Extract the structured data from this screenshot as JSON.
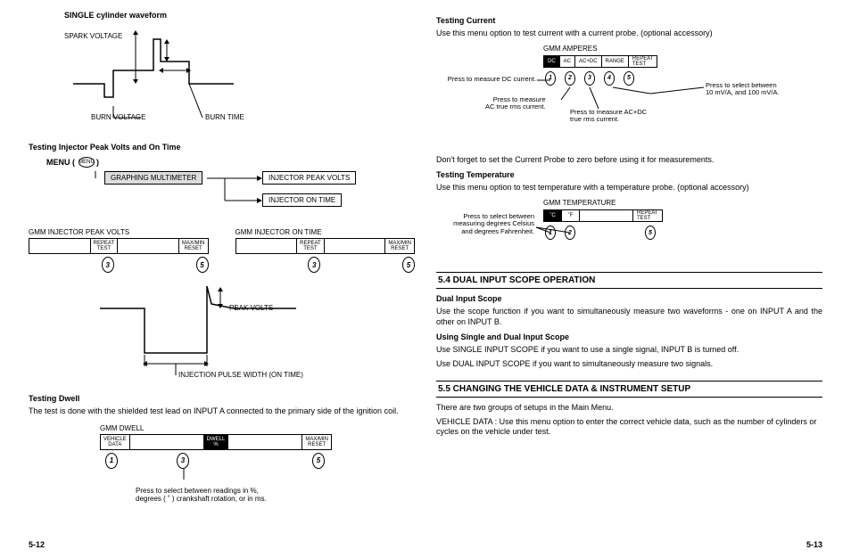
{
  "left": {
    "wave_title": "SINGLE cylinder waveform",
    "spark_v": "SPARK VOLTAGE",
    "burn_v": "BURN VOLTAGE",
    "burn_t": "BURN TIME",
    "inj_title": "Testing Injector Peak Volts and On Time",
    "menu_label": "MENU (",
    "menu_btn": "MENU",
    "menu_close": ")",
    "gm_box": "GRAPHING MULTIMETER",
    "ipv_box": "INJECTOR PEAK VOLTS",
    "iot_box": "INJECTOR ON TIME",
    "inst1_title": "GMM INJECTOR PEAK VOLTS",
    "inst2_title": "GMM INJECTOR ON TIME",
    "repeat_test": "REPEAT\nTEST",
    "maxmin_reset": "MAX/MIN\nRESET",
    "btn3": "3",
    "btn5": "5",
    "peak_volts": "PEAK VOLTS",
    "inj_pulse": "INJECTION PULSE WIDTH (ON TIME)",
    "dwell_title": "Testing Dwell",
    "dwell_para": "The test is done with the shielded test lead on INPUT A connected to the primary side of the ignition coil.",
    "dwell_inst": "GMM DWELL",
    "vehicle_data": "VEHICLE\nDATA",
    "dwell_cell": "DWELL\n%",
    "btn1": "1",
    "dwell_note": "Press to select between readings in %,\ndegrees ( ˚ ) crankshaft rotation, or in ms.",
    "page": "5-12"
  },
  "right": {
    "tc_title": "Testing Current",
    "tc_para": "Use this menu option to test current with a current probe. (optional accessory)",
    "amp_title": "GMM AMPERES",
    "dc": "DC",
    "ac": "AC",
    "acdc": "AC+DC",
    "range": "RANGE",
    "repeat_test": "REPEAT\nTEST",
    "c_dc": "Press to measure DC current.",
    "c_ac": "Press to measure\nAC true rms current.",
    "c_acdc": "Press to measure AC+DC\ntrue rms current.",
    "c_range": "Press to select between\n10 mV/A, and 100 mV/A.",
    "b1": "1",
    "b2": "2",
    "b3": "3",
    "b4": "4",
    "b5": "5",
    "probe_note": "Don't forget to set the Current Probe to zero before using it for measurements.",
    "tt_title": "Testing Temperature",
    "tt_para": "Use this menu option to test temperature with a temperature probe. (optional accessory)",
    "temp_title": "GMM TEMPERATURE",
    "degC": "˚C",
    "degF": "˚F",
    "temp_note": "Press to select between\nmeasuring degrees Celsius\nand degrees Fahrenheit.",
    "s54": "5.4 DUAL INPUT SCOPE OPERATION",
    "dis_title": "Dual Input Scope",
    "dis_para": "Use the scope function if you want to simultaneously measure two waveforms - one on INPUT A and the other on INPUT B.",
    "usdis_title": "Using Single and Dual Input Scope",
    "usdis_p1": "Use SINGLE INPUT SCOPE if you want to use a single signal, INPUT B is turned off.",
    "usdis_p2": "Use DUAL INPUT SCOPE if you want to simultaneously measure two signals.",
    "s55": "5.5 CHANGING THE VEHICLE DATA & INSTRUMENT SETUP",
    "s55_p1": "There are two groups of setups in the Main Menu.",
    "s55_p2": "VEHICLE DATA : Use this menu option to enter the correct vehicle data, such as the number of cylinders or cycles on the vehicle under test.",
    "page": "5-13"
  }
}
